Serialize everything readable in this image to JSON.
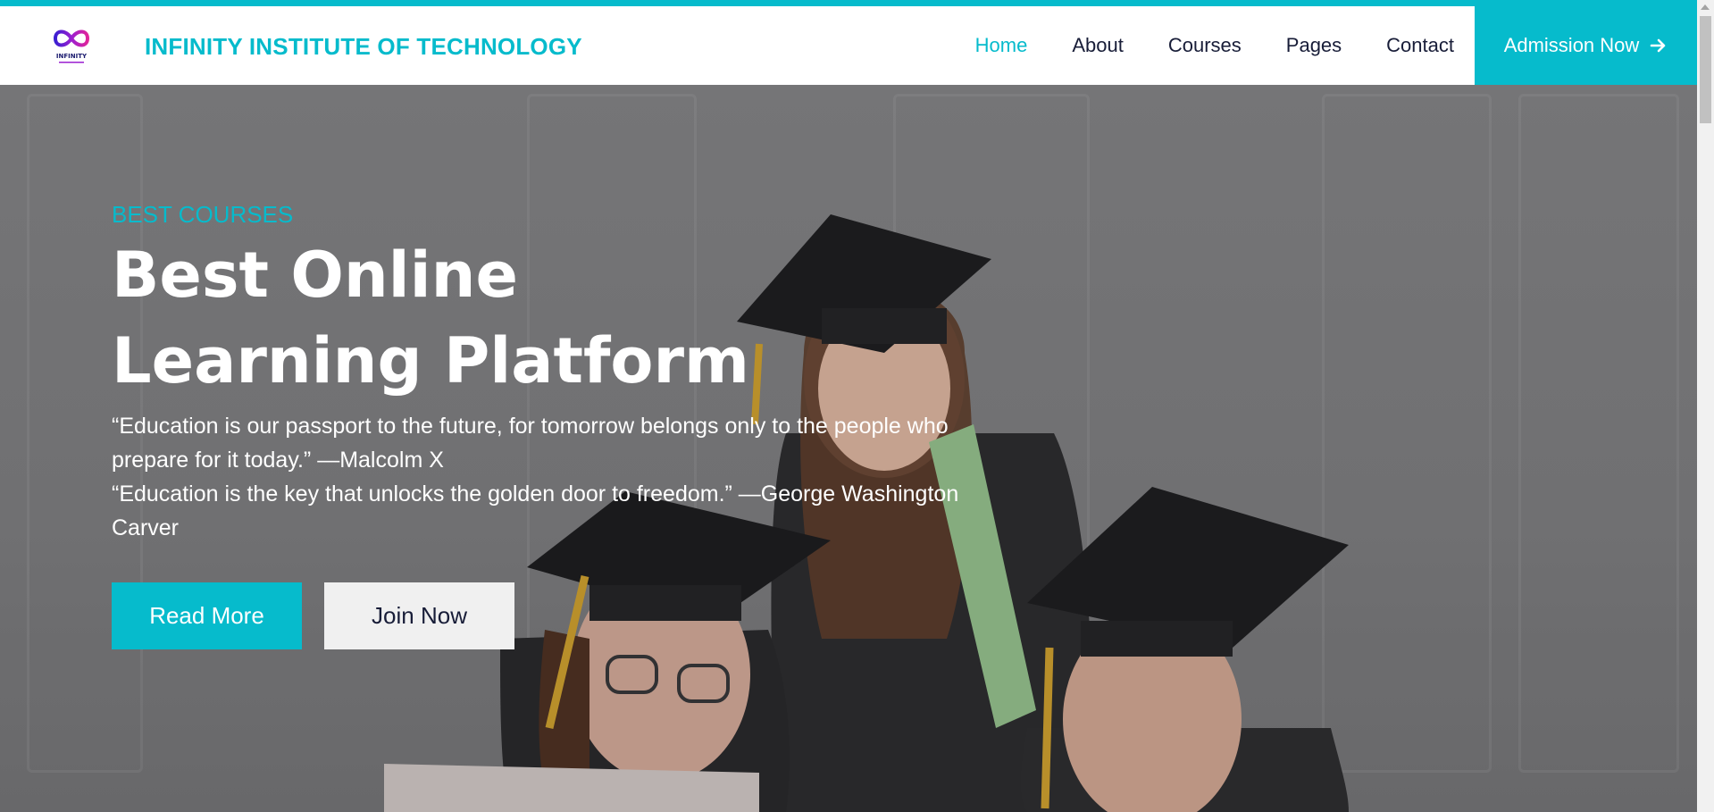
{
  "brand": {
    "name": "INFINITY INSTITUTE OF TECHNOLOGY",
    "logo_text": "INFINITY",
    "accent_color": "#06BBCC"
  },
  "nav": {
    "items": [
      {
        "label": "Home",
        "active": true
      },
      {
        "label": "About",
        "active": false
      },
      {
        "label": "Courses",
        "active": false
      },
      {
        "label": "Pages",
        "active": false
      },
      {
        "label": "Contact",
        "active": false
      }
    ],
    "cta_label": "Admission Now",
    "cta_icon": "arrow-right-icon"
  },
  "hero": {
    "eyebrow": "BEST COURSES",
    "headline": "Best Online Learning Platform",
    "quote_1": "“Education is our passport to the future, for tomorrow belongs only to the people who prepare for it today.” —Malcolm X",
    "quote_2": "“Education is the key that unlocks the golden door to freedom.” —George Washington Carver",
    "primary_button": "Read More",
    "secondary_button": "Join Now"
  }
}
